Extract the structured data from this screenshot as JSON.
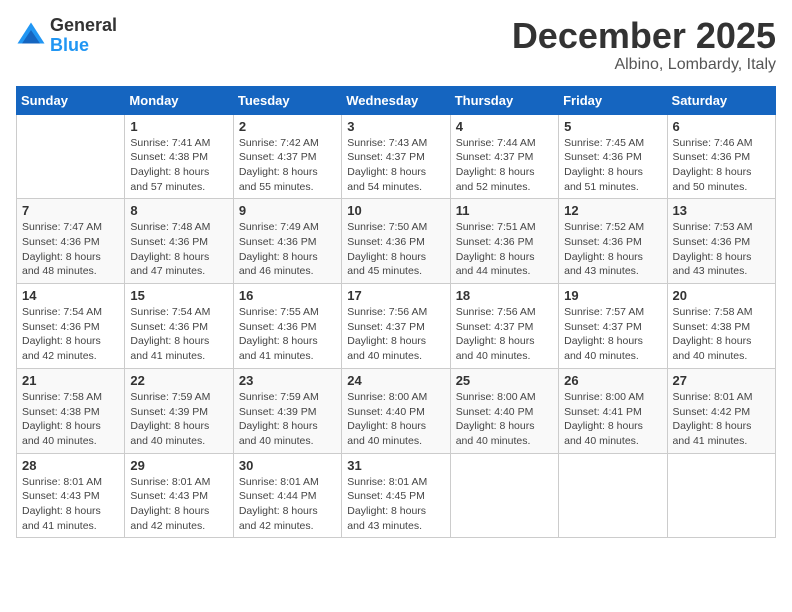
{
  "logo": {
    "general": "General",
    "blue": "Blue"
  },
  "title": {
    "month": "December 2025",
    "location": "Albino, Lombardy, Italy"
  },
  "headers": [
    "Sunday",
    "Monday",
    "Tuesday",
    "Wednesday",
    "Thursday",
    "Friday",
    "Saturday"
  ],
  "weeks": [
    [
      {
        "day": "",
        "sunrise": "",
        "sunset": "",
        "daylight": ""
      },
      {
        "day": "1",
        "sunrise": "Sunrise: 7:41 AM",
        "sunset": "Sunset: 4:38 PM",
        "daylight": "Daylight: 8 hours and 57 minutes."
      },
      {
        "day": "2",
        "sunrise": "Sunrise: 7:42 AM",
        "sunset": "Sunset: 4:37 PM",
        "daylight": "Daylight: 8 hours and 55 minutes."
      },
      {
        "day": "3",
        "sunrise": "Sunrise: 7:43 AM",
        "sunset": "Sunset: 4:37 PM",
        "daylight": "Daylight: 8 hours and 54 minutes."
      },
      {
        "day": "4",
        "sunrise": "Sunrise: 7:44 AM",
        "sunset": "Sunset: 4:37 PM",
        "daylight": "Daylight: 8 hours and 52 minutes."
      },
      {
        "day": "5",
        "sunrise": "Sunrise: 7:45 AM",
        "sunset": "Sunset: 4:36 PM",
        "daylight": "Daylight: 8 hours and 51 minutes."
      },
      {
        "day": "6",
        "sunrise": "Sunrise: 7:46 AM",
        "sunset": "Sunset: 4:36 PM",
        "daylight": "Daylight: 8 hours and 50 minutes."
      }
    ],
    [
      {
        "day": "7",
        "sunrise": "Sunrise: 7:47 AM",
        "sunset": "Sunset: 4:36 PM",
        "daylight": "Daylight: 8 hours and 48 minutes."
      },
      {
        "day": "8",
        "sunrise": "Sunrise: 7:48 AM",
        "sunset": "Sunset: 4:36 PM",
        "daylight": "Daylight: 8 hours and 47 minutes."
      },
      {
        "day": "9",
        "sunrise": "Sunrise: 7:49 AM",
        "sunset": "Sunset: 4:36 PM",
        "daylight": "Daylight: 8 hours and 46 minutes."
      },
      {
        "day": "10",
        "sunrise": "Sunrise: 7:50 AM",
        "sunset": "Sunset: 4:36 PM",
        "daylight": "Daylight: 8 hours and 45 minutes."
      },
      {
        "day": "11",
        "sunrise": "Sunrise: 7:51 AM",
        "sunset": "Sunset: 4:36 PM",
        "daylight": "Daylight: 8 hours and 44 minutes."
      },
      {
        "day": "12",
        "sunrise": "Sunrise: 7:52 AM",
        "sunset": "Sunset: 4:36 PM",
        "daylight": "Daylight: 8 hours and 43 minutes."
      },
      {
        "day": "13",
        "sunrise": "Sunrise: 7:53 AM",
        "sunset": "Sunset: 4:36 PM",
        "daylight": "Daylight: 8 hours and 43 minutes."
      }
    ],
    [
      {
        "day": "14",
        "sunrise": "Sunrise: 7:54 AM",
        "sunset": "Sunset: 4:36 PM",
        "daylight": "Daylight: 8 hours and 42 minutes."
      },
      {
        "day": "15",
        "sunrise": "Sunrise: 7:54 AM",
        "sunset": "Sunset: 4:36 PM",
        "daylight": "Daylight: 8 hours and 41 minutes."
      },
      {
        "day": "16",
        "sunrise": "Sunrise: 7:55 AM",
        "sunset": "Sunset: 4:36 PM",
        "daylight": "Daylight: 8 hours and 41 minutes."
      },
      {
        "day": "17",
        "sunrise": "Sunrise: 7:56 AM",
        "sunset": "Sunset: 4:37 PM",
        "daylight": "Daylight: 8 hours and 40 minutes."
      },
      {
        "day": "18",
        "sunrise": "Sunrise: 7:56 AM",
        "sunset": "Sunset: 4:37 PM",
        "daylight": "Daylight: 8 hours and 40 minutes."
      },
      {
        "day": "19",
        "sunrise": "Sunrise: 7:57 AM",
        "sunset": "Sunset: 4:37 PM",
        "daylight": "Daylight: 8 hours and 40 minutes."
      },
      {
        "day": "20",
        "sunrise": "Sunrise: 7:58 AM",
        "sunset": "Sunset: 4:38 PM",
        "daylight": "Daylight: 8 hours and 40 minutes."
      }
    ],
    [
      {
        "day": "21",
        "sunrise": "Sunrise: 7:58 AM",
        "sunset": "Sunset: 4:38 PM",
        "daylight": "Daylight: 8 hours and 40 minutes."
      },
      {
        "day": "22",
        "sunrise": "Sunrise: 7:59 AM",
        "sunset": "Sunset: 4:39 PM",
        "daylight": "Daylight: 8 hours and 40 minutes."
      },
      {
        "day": "23",
        "sunrise": "Sunrise: 7:59 AM",
        "sunset": "Sunset: 4:39 PM",
        "daylight": "Daylight: 8 hours and 40 minutes."
      },
      {
        "day": "24",
        "sunrise": "Sunrise: 8:00 AM",
        "sunset": "Sunset: 4:40 PM",
        "daylight": "Daylight: 8 hours and 40 minutes."
      },
      {
        "day": "25",
        "sunrise": "Sunrise: 8:00 AM",
        "sunset": "Sunset: 4:40 PM",
        "daylight": "Daylight: 8 hours and 40 minutes."
      },
      {
        "day": "26",
        "sunrise": "Sunrise: 8:00 AM",
        "sunset": "Sunset: 4:41 PM",
        "daylight": "Daylight: 8 hours and 40 minutes."
      },
      {
        "day": "27",
        "sunrise": "Sunrise: 8:01 AM",
        "sunset": "Sunset: 4:42 PM",
        "daylight": "Daylight: 8 hours and 41 minutes."
      }
    ],
    [
      {
        "day": "28",
        "sunrise": "Sunrise: 8:01 AM",
        "sunset": "Sunset: 4:43 PM",
        "daylight": "Daylight: 8 hours and 41 minutes."
      },
      {
        "day": "29",
        "sunrise": "Sunrise: 8:01 AM",
        "sunset": "Sunset: 4:43 PM",
        "daylight": "Daylight: 8 hours and 42 minutes."
      },
      {
        "day": "30",
        "sunrise": "Sunrise: 8:01 AM",
        "sunset": "Sunset: 4:44 PM",
        "daylight": "Daylight: 8 hours and 42 minutes."
      },
      {
        "day": "31",
        "sunrise": "Sunrise: 8:01 AM",
        "sunset": "Sunset: 4:45 PM",
        "daylight": "Daylight: 8 hours and 43 minutes."
      },
      {
        "day": "",
        "sunrise": "",
        "sunset": "",
        "daylight": ""
      },
      {
        "day": "",
        "sunrise": "",
        "sunset": "",
        "daylight": ""
      },
      {
        "day": "",
        "sunrise": "",
        "sunset": "",
        "daylight": ""
      }
    ]
  ]
}
